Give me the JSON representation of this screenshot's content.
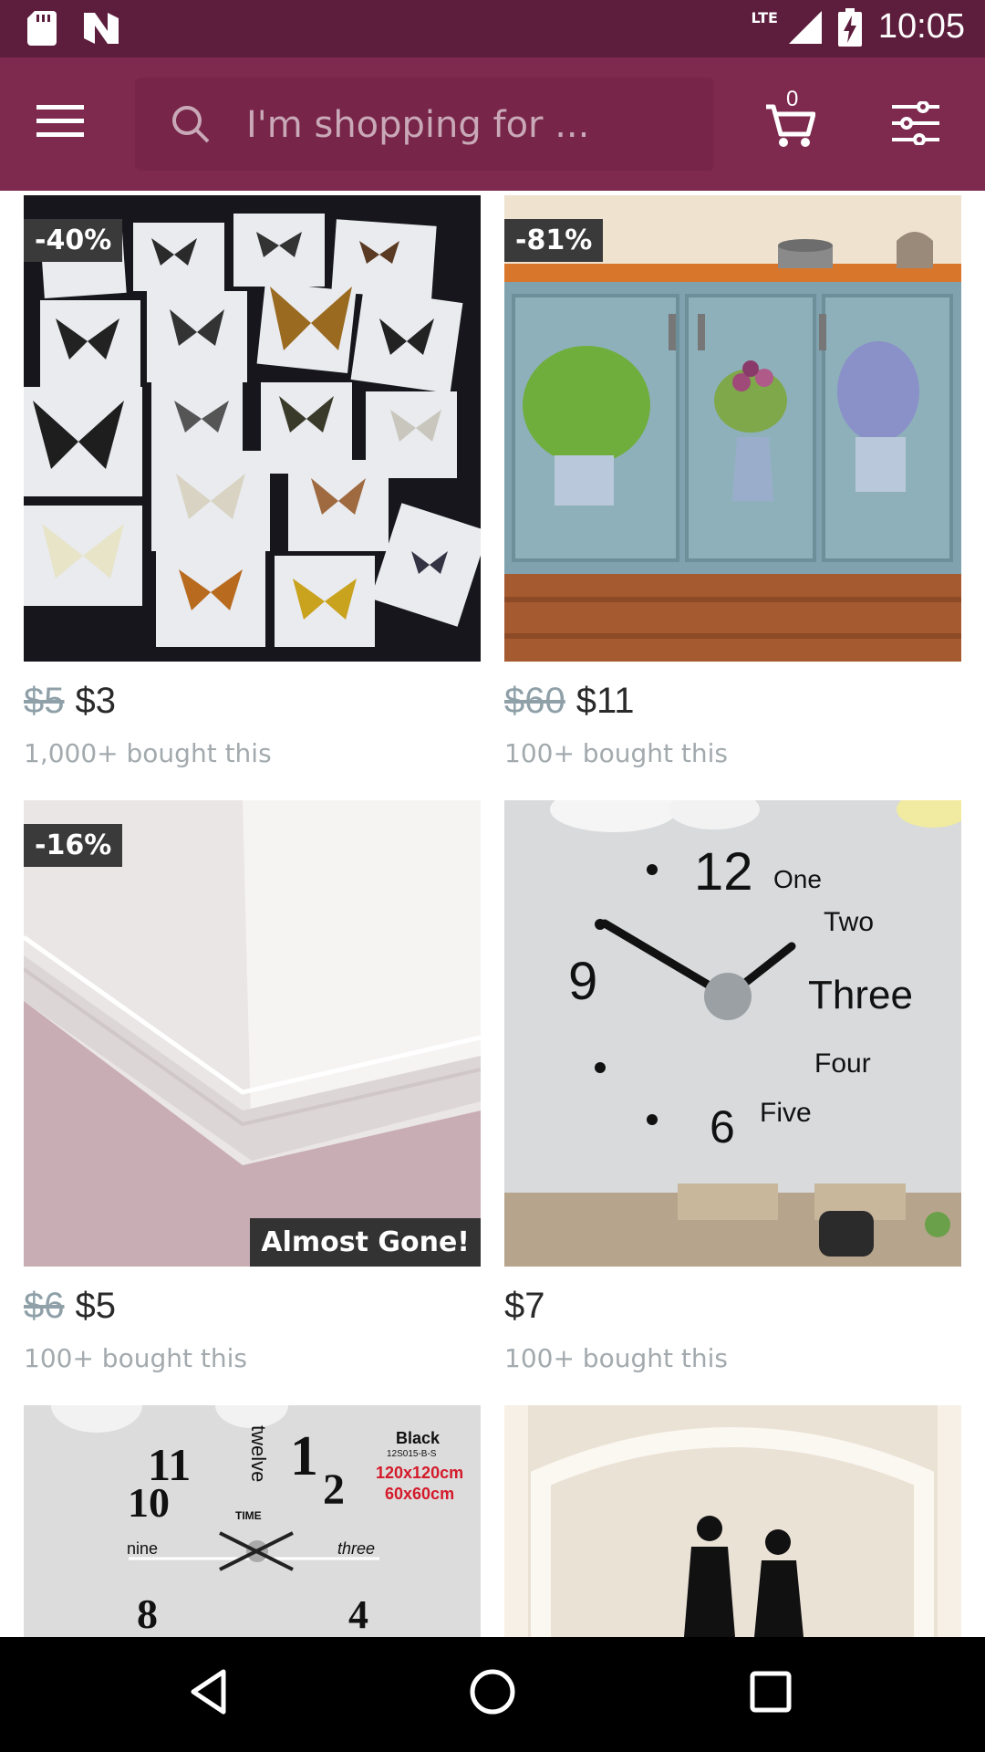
{
  "status_bar": {
    "time": "10:05",
    "network": "LTE",
    "icons": [
      "sd-card-icon",
      "n-app-icon",
      "signal-icon",
      "battery-charging-icon"
    ]
  },
  "header": {
    "search_placeholder": "I'm shopping for ...",
    "cart_count": "0",
    "icons": [
      "menu-icon",
      "search-icon",
      "cart-icon",
      "filter-icon"
    ]
  },
  "products": [
    {
      "discount": "-40%",
      "old_price": "$5",
      "price": "$3",
      "bought": "1,000+ bought this"
    },
    {
      "discount": "-81%",
      "old_price": "$60",
      "price": "$11",
      "bought": "100+ bought this"
    },
    {
      "discount": "-16%",
      "old_price": "$6",
      "price": "$5",
      "bought": "100+ bought this",
      "tag": "Almost Gone!"
    },
    {
      "discount": "",
      "old_price": "",
      "price": "$7",
      "bought": "100+ bought this",
      "clock_text": {
        "twelve": "12",
        "nine": "9",
        "six": "6",
        "one": "One",
        "two": "Two",
        "three": "Three",
        "four": "Four",
        "five": "Five"
      }
    },
    {
      "clock_text": {
        "title": "Black",
        "code": "12S015-B-S",
        "size1": "120x120cm",
        "size2": "60x60cm",
        "n11": "11",
        "n10": "10",
        "n1": "1",
        "n2": "2",
        "n8": "8",
        "n4": "4",
        "twelve_word": "twelve",
        "time_word": "TIME",
        "nine_word": "nine",
        "three_word": "three"
      }
    },
    {}
  ],
  "nav": {
    "icons": [
      "back-icon",
      "home-icon",
      "recents-icon"
    ]
  },
  "colors": {
    "status_bar": "#5d1d3c",
    "app_bar": "#7e2a4f",
    "search_bg": "#772548"
  }
}
